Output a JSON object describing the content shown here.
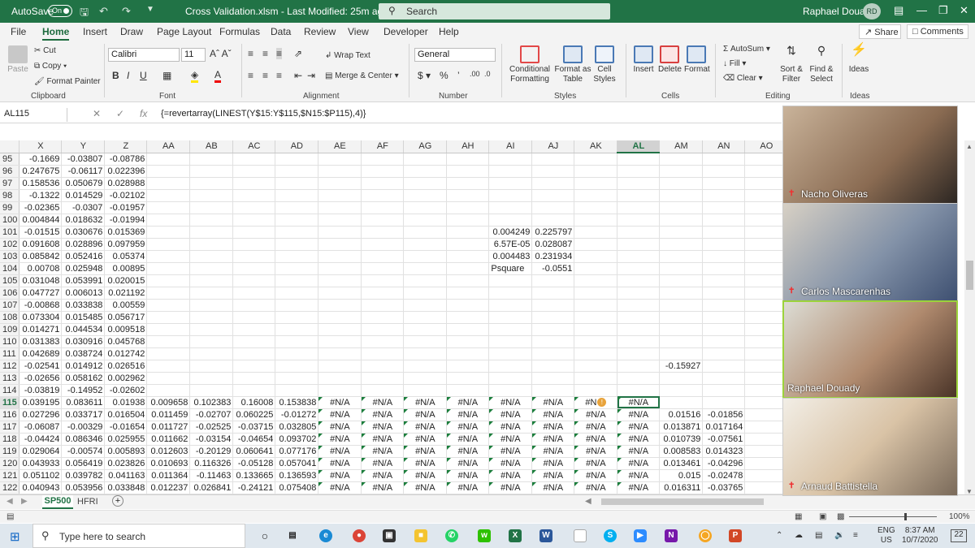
{
  "titlebar": {
    "autosave": "AutoSave",
    "autosave_state": "On",
    "file_title": "Cross Validation.xlsm  -  Last Modified: 25m ago  ⌵",
    "search_placeholder": "Search",
    "user_name": "Raphael Douady",
    "user_initials": "RD"
  },
  "menu": {
    "items": [
      "File",
      "Home",
      "Insert",
      "Draw",
      "Page Layout",
      "Formulas",
      "Data",
      "Review",
      "View",
      "Developer",
      "Help"
    ],
    "share": "Share",
    "comments": "Comments"
  },
  "ribbon": {
    "paste": "Paste",
    "cut": "Cut",
    "copy": "Copy",
    "format_painter": "Format Painter",
    "clipboard": "Clipboard",
    "font_name": "Calibri",
    "font_size": "11",
    "font_group": "Font",
    "wrap_text": "Wrap Text",
    "merge_center": "Merge & Center",
    "alignment": "Alignment",
    "number_format": "General",
    "number": "Number",
    "conditional_formatting": "Conditional Formatting",
    "format_as_table": "Format as Table",
    "cell_styles": "Cell Styles",
    "styles": "Styles",
    "insert": "Insert",
    "delete": "Delete",
    "format": "Format",
    "cells": "Cells",
    "autosum": "AutoSum",
    "fill": "Fill",
    "clear": "Clear",
    "sort_filter": "Sort & Filter",
    "find_select": "Find & Select",
    "editing": "Editing",
    "ideas": "Ideas",
    "ideas_group": "Ideas"
  },
  "formula_bar": {
    "name_box": "AL115",
    "formula": "{=revertarray(LINEST(Y$15:Y$115,$N15:$P115),4)}"
  },
  "sheet": {
    "columns": [
      "X",
      "Y",
      "Z",
      "AA",
      "AB",
      "AC",
      "AD",
      "AE",
      "AF",
      "AG",
      "AH",
      "AI",
      "AJ",
      "AK",
      "AL",
      "AM",
      "AN",
      "AO"
    ],
    "selected_column": "AL",
    "selected_row": "115",
    "rows": [
      {
        "n": "95",
        "c": {
          "X": "-0.1669",
          "Y": "-0.03807",
          "Z": "-0.08786"
        }
      },
      {
        "n": "96",
        "c": {
          "X": "0.247675",
          "Y": "-0.06117",
          "Z": "0.022396"
        }
      },
      {
        "n": "97",
        "c": {
          "X": "0.158536",
          "Y": "0.050679",
          "Z": "0.028988"
        }
      },
      {
        "n": "98",
        "c": {
          "X": "-0.1322",
          "Y": "0.014529",
          "Z": "-0.02102"
        }
      },
      {
        "n": "99",
        "c": {
          "X": "-0.02365",
          "Y": "-0.0307",
          "Z": "-0.01957"
        }
      },
      {
        "n": "100",
        "c": {
          "X": "0.004844",
          "Y": "0.018632",
          "Z": "-0.01994"
        }
      },
      {
        "n": "101",
        "c": {
          "X": "-0.01515",
          "Y": "0.030676",
          "Z": "0.015369",
          "AI": "0.004249",
          "AJ": "0.225797"
        }
      },
      {
        "n": "102",
        "c": {
          "X": "0.091608",
          "Y": "0.028896",
          "Z": "0.097959",
          "AI": "6.57E-05",
          "AJ": "0.028087"
        }
      },
      {
        "n": "103",
        "c": {
          "X": "0.085842",
          "Y": "0.052416",
          "Z": "0.05374",
          "AI": "0.004483",
          "AJ": "0.231934"
        }
      },
      {
        "n": "104",
        "c": {
          "X": "0.00708",
          "Y": "0.025948",
          "Z": "0.00895",
          "AI": "Psquare",
          "AJ": "-0.0551"
        }
      },
      {
        "n": "105",
        "c": {
          "X": "0.031048",
          "Y": "0.053991",
          "Z": "0.020015"
        }
      },
      {
        "n": "106",
        "c": {
          "X": "0.047727",
          "Y": "0.006013",
          "Z": "0.021192"
        }
      },
      {
        "n": "107",
        "c": {
          "X": "-0.00868",
          "Y": "0.033838",
          "Z": "0.00559"
        }
      },
      {
        "n": "108",
        "c": {
          "X": "0.073304",
          "Y": "0.015485",
          "Z": "0.056717"
        }
      },
      {
        "n": "109",
        "c": {
          "X": "0.014271",
          "Y": "0.044534",
          "Z": "0.009518"
        }
      },
      {
        "n": "110",
        "c": {
          "X": "0.031383",
          "Y": "0.030916",
          "Z": "0.045768"
        }
      },
      {
        "n": "111",
        "c": {
          "X": "0.042689",
          "Y": "0.038724",
          "Z": "0.012742"
        }
      },
      {
        "n": "112",
        "c": {
          "X": "-0.02541",
          "Y": "0.014912",
          "Z": "0.026516",
          "AM": "-0.15927"
        }
      },
      {
        "n": "113",
        "c": {
          "X": "-0.02656",
          "Y": "0.058162",
          "Z": "0.002962"
        }
      },
      {
        "n": "114",
        "c": {
          "X": "-0.03819",
          "Y": "-0.14952",
          "Z": "-0.02602"
        }
      },
      {
        "n": "115",
        "c": {
          "X": "0.039195",
          "Y": "0.083611",
          "Z": "0.01938",
          "AA": "0.009658",
          "AB": "0.102383",
          "AC": "0.16008",
          "AD": "0.153838",
          "AE": "#N/A",
          "AF": "#N/A",
          "AG": "#N/A",
          "AH": "#N/A",
          "AI": "#N/A",
          "AJ": "#N/A",
          "AK": "#N",
          "AL": "#N/A"
        }
      },
      {
        "n": "116",
        "c": {
          "X": "0.027296",
          "Y": "0.033717",
          "Z": "0.016504",
          "AA": "0.011459",
          "AB": "-0.02707",
          "AC": "0.060225",
          "AD": "-0.01272",
          "AE": "#N/A",
          "AF": "#N/A",
          "AG": "#N/A",
          "AH": "#N/A",
          "AI": "#N/A",
          "AJ": "#N/A",
          "AK": "#N/A",
          "AL": "#N/A",
          "AM": "0.01516",
          "AN": "-0.01856"
        }
      },
      {
        "n": "117",
        "c": {
          "X": "-0.06087",
          "Y": "-0.00329",
          "Z": "-0.01654",
          "AA": "0.011727",
          "AB": "-0.02525",
          "AC": "-0.03715",
          "AD": "0.032805",
          "AE": "#N/A",
          "AF": "#N/A",
          "AG": "#N/A",
          "AH": "#N/A",
          "AI": "#N/A",
          "AJ": "#N/A",
          "AK": "#N/A",
          "AL": "#N/A",
          "AM": "0.013871",
          "AN": "0.017164"
        }
      },
      {
        "n": "118",
        "c": {
          "X": "-0.04424",
          "Y": "0.086346",
          "Z": "0.025955",
          "AA": "0.011662",
          "AB": "-0.03154",
          "AC": "-0.04654",
          "AD": "0.093702",
          "AE": "#N/A",
          "AF": "#N/A",
          "AG": "#N/A",
          "AH": "#N/A",
          "AI": "#N/A",
          "AJ": "#N/A",
          "AK": "#N/A",
          "AL": "#N/A",
          "AM": "0.010739",
          "AN": "-0.07561"
        }
      },
      {
        "n": "119",
        "c": {
          "X": "0.029064",
          "Y": "-0.00574",
          "Z": "0.005893",
          "AA": "0.012603",
          "AB": "-0.20129",
          "AC": "0.060641",
          "AD": "0.077176",
          "AE": "#N/A",
          "AF": "#N/A",
          "AG": "#N/A",
          "AH": "#N/A",
          "AI": "#N/A",
          "AJ": "#N/A",
          "AK": "#N/A",
          "AL": "#N/A",
          "AM": "0.008583",
          "AN": "0.014323"
        }
      },
      {
        "n": "120",
        "c": {
          "X": "0.043933",
          "Y": "0.056419",
          "Z": "0.023826",
          "AA": "0.010693",
          "AB": "0.116326",
          "AC": "-0.05128",
          "AD": "0.057041",
          "AE": "#N/A",
          "AF": "#N/A",
          "AG": "#N/A",
          "AH": "#N/A",
          "AI": "#N/A",
          "AJ": "#N/A",
          "AK": "#N/A",
          "AL": "#N/A",
          "AM": "0.013461",
          "AN": "-0.04296"
        }
      },
      {
        "n": "121",
        "c": {
          "X": "0.051102",
          "Y": "0.039782",
          "Z": "0.041163",
          "AA": "0.011364",
          "AB": "-0.11463",
          "AC": "0.133665",
          "AD": "0.136593",
          "AE": "#N/A",
          "AF": "#N/A",
          "AG": "#N/A",
          "AH": "#N/A",
          "AI": "#N/A",
          "AJ": "#N/A",
          "AK": "#N/A",
          "AL": "#N/A",
          "AM": "0.015",
          "AN": "-0.02478"
        }
      },
      {
        "n": "122",
        "c": {
          "X": "0.040943",
          "Y": "0.053956",
          "Z": "0.033848",
          "AA": "0.012237",
          "AB": "0.026841",
          "AC": "-0.24121",
          "AD": "0.075408",
          "AE": "#N/A",
          "AF": "#N/A",
          "AG": "#N/A",
          "AH": "#N/A",
          "AI": "#N/A",
          "AJ": "#N/A",
          "AK": "#N/A",
          "AL": "#N/A",
          "AM": "0.016311",
          "AN": "-0.03765"
        }
      }
    ]
  },
  "sheet_tabs": {
    "active": "SP500",
    "other": "HFRI",
    "add": "+"
  },
  "status": {
    "zoom": "100%"
  },
  "taskbar": {
    "search_placeholder": "Type here to search",
    "lang": "ENG",
    "region": "US",
    "time": "8:37 AM",
    "date": "10/7/2020",
    "notif": "22"
  },
  "video_panel": {
    "participants": [
      {
        "name": "Nacho Oliveras",
        "muted": true
      },
      {
        "name": "Carlos Mascarenhas",
        "muted": true
      },
      {
        "name": "Raphael Douady",
        "muted": false
      },
      {
        "name": "Arnaud Battistella",
        "muted": true
      }
    ]
  },
  "colors": {
    "excel_green": "#217346",
    "speaker_border": "#9cd33b",
    "mute_red": "#e33333"
  }
}
